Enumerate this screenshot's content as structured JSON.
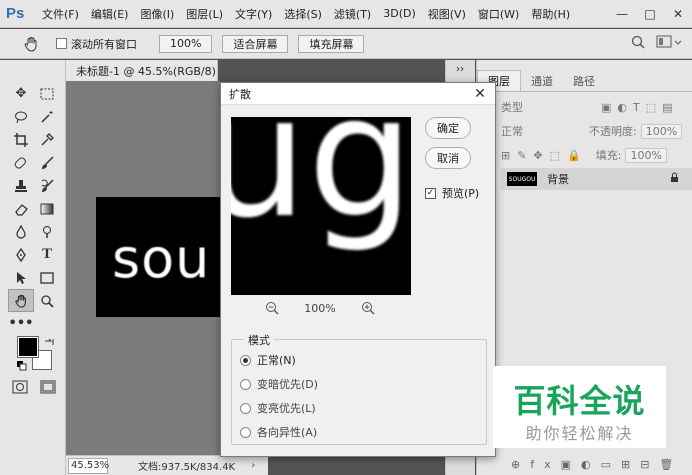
{
  "app": {
    "logo": "Ps",
    "menus": [
      "文件(F)",
      "编辑(E)",
      "图像(I)",
      "图层(L)",
      "文字(Y)",
      "选择(S)",
      "滤镜(T)",
      "3D(D)",
      "视图(V)",
      "窗口(W)",
      "帮助(H)"
    ],
    "window_controls": {
      "minimize": "—",
      "maximize": "□",
      "close": "✕"
    }
  },
  "options_bar": {
    "scroll_all_label": "滚动所有窗口",
    "zoom_button": "100%",
    "fit_screen_button": "适合屏幕",
    "fill_screen_button": "填充屏幕"
  },
  "document": {
    "tab_title": "未标题-1 @ 45.5%(RGB/8) *",
    "canvas_text": "sou",
    "zoom": "45.53%",
    "doc_info": "文档:937.5K/834.4K"
  },
  "layers_panel": {
    "tabs": [
      "图层",
      "通道",
      "路径"
    ],
    "kind_placeholder": "类型",
    "blend_mode": "正常",
    "opacity_label": "不透明度:",
    "opacity_value": "100%",
    "fill_label": "填充:",
    "fill_value": "100%",
    "layer_thumb_text": "SOUGOU",
    "layer_name": "背景"
  },
  "dialog": {
    "title": "扩散",
    "preview_text": "ug",
    "ok_label": "确定",
    "cancel_label": "取消",
    "preview_label": "预览(P)",
    "zoom_value": "100%",
    "mode_title": "模式",
    "modes": [
      "正常(N)",
      "变暗优先(D)",
      "变亮优先(L)",
      "各向异性(A)"
    ],
    "selected_mode": 0
  },
  "watermark": {
    "title": "百科全说",
    "subtitle": "助你轻松解决"
  },
  "colors": {
    "accent_green": "#1aa35b",
    "ps_blue": "#2c6fb5"
  }
}
